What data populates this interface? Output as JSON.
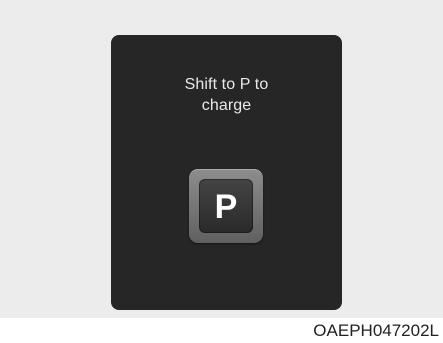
{
  "display": {
    "message_line1": "Shift to P to",
    "message_line2": "charge",
    "gear_indicator": "P"
  },
  "icon": "gear-p-icon",
  "caption": "OAEPH047202L",
  "colors": {
    "screen": "#262626",
    "text": "#e9e9e9",
    "badge_outer": "#7a7a7a",
    "badge_inner": "#333333",
    "background": "#ececec"
  }
}
